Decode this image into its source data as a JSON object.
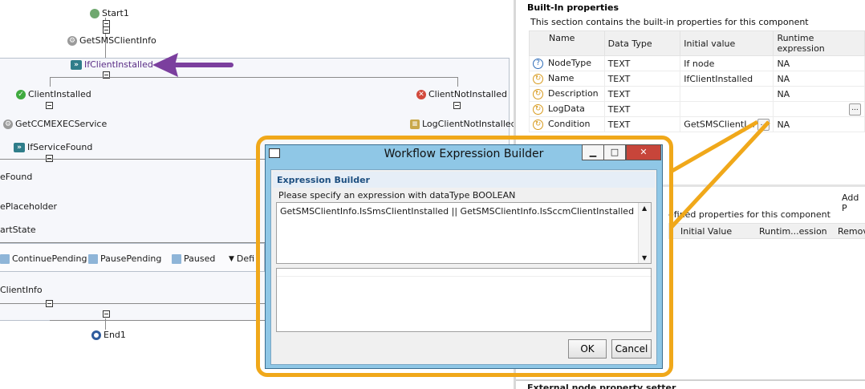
{
  "workflow": {
    "nodes": {
      "start1": "Start1",
      "get_sms_client_info": "GetSMSClientInfo",
      "if_client_installed": "IfClientInstalled",
      "client_installed": "ClientInstalled",
      "client_not_installed": "ClientNotInstalled",
      "get_ccmexec_service": "GetCCMEXECService",
      "log_client_not_installed": "LogClientNotInstalled",
      "if_service_found": "IfServiceFound",
      "e_found": "eFound",
      "e_placeholder": "ePlaceholder",
      "art_state": "artState",
      "continue_pending": "ContinuePending",
      "pause_pending": "PausePending",
      "paused": "Paused",
      "defi": "Defi",
      "client_info": "ClientInfo",
      "end1": "End1"
    }
  },
  "builtin": {
    "title": "Built-In properties",
    "subtitle": "This section contains the built-in properties for this component",
    "columns": [
      "Name",
      "Data Type",
      "Initial value",
      "Runtime expression"
    ],
    "rows": [
      {
        "name": "NodeType",
        "type": "TEXT",
        "initial": "If node",
        "runtime": "NA"
      },
      {
        "name": "Name",
        "type": "TEXT",
        "initial": "IfClientInstalled",
        "runtime": "NA"
      },
      {
        "name": "Description",
        "type": "TEXT",
        "initial": "",
        "runtime": "NA"
      },
      {
        "name": "LogData",
        "type": "TEXT",
        "initial": "",
        "runtime": ""
      },
      {
        "name": "Condition",
        "type": "TEXT",
        "initial": "GetSMSClientI...",
        "runtime": "NA"
      }
    ],
    "ellipsis": "...",
    "condition_ellipsis": "..."
  },
  "userdefined": {
    "add_label": "Add P",
    "subtitle_fragment": "efined properties for this component",
    "columns": [
      "Initial Value",
      "Runtim...ession",
      "Remov"
    ]
  },
  "external_fragment": "External node property setter",
  "dialog": {
    "title": "Workflow Expression Builder",
    "group_label": "Expression Builder",
    "prompt": "Please specify an expression with dataType BOOLEAN",
    "expression": "GetSMSClientInfo.IsSmsClientInstalled || GetSMSClientInfo.IsSccmClientInstalled",
    "ok_label": "OK",
    "cancel_label": "Cancel",
    "minimize_glyph": "▁",
    "maximize_glyph": "□",
    "close_glyph": "✕"
  },
  "colors": {
    "callout": "#f0a81a",
    "arrow": "#7b3f9e",
    "dialog_frame": "#8fc7e6",
    "close_button": "#c7453a"
  }
}
